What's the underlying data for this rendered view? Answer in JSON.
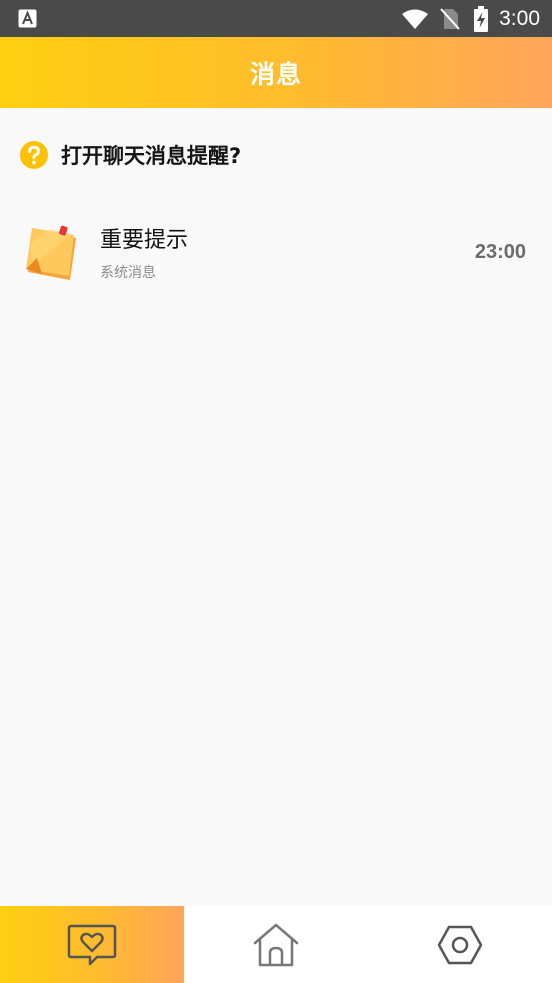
{
  "status_bar": {
    "time": "3:00",
    "icons": [
      "app-notification-icon",
      "wifi-icon",
      "no-sim-icon",
      "battery-charging-icon"
    ]
  },
  "header": {
    "title": "消息"
  },
  "prompt": {
    "text": "打开聊天消息提醒?",
    "icon": "question-icon"
  },
  "messages": [
    {
      "title": "重要提示",
      "subtitle": "系统消息",
      "time": "23:00",
      "icon": "sticky-note-icon"
    }
  ],
  "bottom_nav": {
    "active_index": 0,
    "tabs": [
      {
        "icon": "chat-heart-icon"
      },
      {
        "icon": "home-icon"
      },
      {
        "icon": "settings-icon"
      }
    ]
  },
  "colors": {
    "gradient_start": "#ffcf10",
    "gradient_end": "#ffa55a",
    "status_bar": "#4a4a4a",
    "background": "#f9f9f9",
    "question_icon": "#ffc000"
  }
}
